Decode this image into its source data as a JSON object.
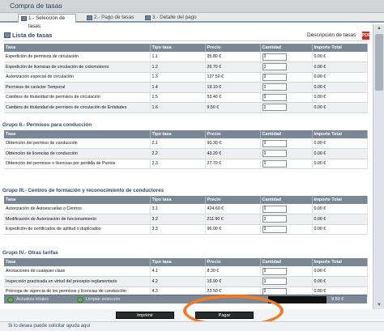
{
  "window": {
    "title": "Compra de tasas"
  },
  "tabs": [
    {
      "label": "1.- Selección de tasas",
      "active": true
    },
    {
      "label": "2.- Pago de tasas",
      "active": false
    },
    {
      "label": "3.- Detalle del pago",
      "active": false
    }
  ],
  "list": {
    "title": "Lista de tasas",
    "description_link": "Descripción de tasas",
    "pdf_icon": "pdf-icon"
  },
  "columns": {
    "tasa": "Tasa",
    "tipo": "Tipo tasa",
    "precio": "Precio",
    "cantidad": "Cantidad",
    "importe": "Importe Total"
  },
  "groups": [
    {
      "title": "",
      "rows": [
        {
          "tasa": "Expedición de permisos de circulación",
          "tipo": "1.1",
          "precio": "95.80 €",
          "cantidad": "0",
          "importe": "0.00 €"
        },
        {
          "tasa": "Expedición de licencias de circulación de ciclomotores",
          "tipo": "1.2",
          "precio": "26.70 €",
          "cantidad": "0",
          "importe": "0.00 €"
        },
        {
          "tasa": "Autorización especial de circulación",
          "tipo": "1.3",
          "precio": "127.50 €",
          "cantidad": "0",
          "importe": "0.00 €"
        },
        {
          "tasa": "Permisos de carácter Temporal",
          "tipo": "1.4",
          "precio": "19.10 €",
          "cantidad": "0",
          "importe": "0.00 €"
        },
        {
          "tasa": "Cambios de titularidad de permisos de circulación",
          "tipo": "1.5",
          "precio": "53.40 €",
          "cantidad": "0",
          "importe": "0.00 €"
        },
        {
          "tasa": "Cambios de titularidad de permisos de circulación de Entidades",
          "tipo": "1.6",
          "precio": "9.50 €",
          "cantidad": "0",
          "importe": "0.00 €"
        }
      ]
    },
    {
      "title": "Grupo II.- Permisos para conducción",
      "rows": [
        {
          "tasa": "Obtención del permiso de conducción",
          "tipo": "2.1",
          "precio": "90.30 €",
          "cantidad": "0",
          "importe": "0.00 €"
        },
        {
          "tasa": "Obtención de licencias de conducción",
          "tipo": "2.2",
          "precio": "43.20 €",
          "cantidad": "0",
          "importe": "0.00 €"
        },
        {
          "tasa": "Obtención del permisos o licencias por perdida de Puntos",
          "tipo": "2.3",
          "precio": "27.70 €",
          "cantidad": "0",
          "importe": "0.00 €"
        }
      ]
    },
    {
      "title": "Grupo III.- Centros de formación y reconocimiento de conductores",
      "rows": [
        {
          "tasa": "Autorización de Autoescuelas o Centros",
          "tipo": "3.1",
          "precio": "424.60 €",
          "cantidad": "0",
          "importe": "0.00 €"
        },
        {
          "tasa": "Modificación de Autorización de funcionamiento",
          "tipo": "3.2",
          "precio": "211.90 €",
          "cantidad": "0",
          "importe": "0.00 €"
        },
        {
          "tasa": "Expedición de certificados de aptitud o duplicados",
          "tipo": "3.3",
          "precio": "96.00 €",
          "cantidad": "0",
          "importe": "0.00 €"
        }
      ]
    },
    {
      "title": "Grupo IV.- Otras tarifas",
      "rows": [
        {
          "tasa": "Anotaciones de cualquier clase",
          "tipo": "4.1",
          "precio": "8.30 €",
          "cantidad": "0",
          "importe": "0.00 €"
        },
        {
          "tasa": "Inspección practicada en virtud del precepto reglamentario",
          "tipo": "4.2",
          "precio": "15.90 €",
          "cantidad": "0",
          "importe": "0.00 €"
        },
        {
          "tasa": "Prórroga de vigencia de los permisos y licencias de conducción",
          "tipo": "4.3",
          "precio": "23.50 €",
          "cantidad": "0",
          "importe": "0.00 €"
        }
      ]
    }
  ],
  "totals": {
    "actualiza_label": "Actualiza totales",
    "limpiar_label": "Limpiar selección",
    "total": "9.50 €"
  },
  "actions": {
    "imprimir_label": "Imprimir",
    "pagar_label": "Pagar"
  },
  "footer": {
    "help_text": "Si lo desea puede solicitar ayuda aquí"
  },
  "colors": {
    "header_bg": "#7a8794",
    "group_title": "#2c4b70",
    "highlight": "#f47a26"
  }
}
